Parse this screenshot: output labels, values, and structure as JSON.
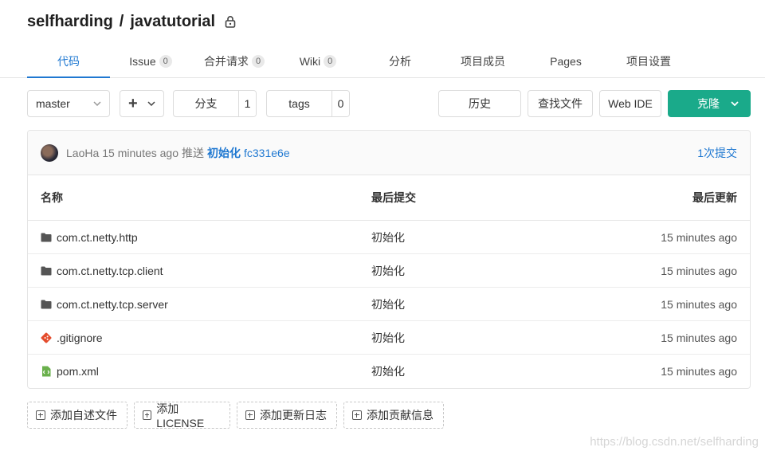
{
  "project": {
    "namespace": "selfharding",
    "separator": "/",
    "name": "javatutorial"
  },
  "tabs": [
    {
      "label": "代码",
      "active": true
    },
    {
      "label": "Issue",
      "count": "0"
    },
    {
      "label": "合并请求",
      "count": "0"
    },
    {
      "label": "Wiki",
      "count": "0"
    },
    {
      "label": "分析"
    },
    {
      "label": "项目成员"
    },
    {
      "label": "Pages"
    },
    {
      "label": "项目设置"
    }
  ],
  "toolbar": {
    "branch": "master",
    "add": "+",
    "branches_label": "分支",
    "branches_count": "1",
    "tags_label": "tags",
    "tags_count": "0",
    "history": "历史",
    "find_file": "查找文件",
    "web_ide": "Web IDE",
    "clone": "克隆"
  },
  "last_commit": {
    "author": "LaoHa",
    "time": "15 minutes ago",
    "action": "推送",
    "message": "初始化",
    "sha": "fc331e6e",
    "total": "1次提交"
  },
  "table": {
    "headers": {
      "name": "名称",
      "last_commit": "最后提交",
      "last_update": "最后更新"
    },
    "rows": [
      {
        "icon": "folder-icon",
        "name": "com.ct.netty.http",
        "commit": "初始化",
        "updated": "15 minutes ago"
      },
      {
        "icon": "folder-icon",
        "name": "com.ct.netty.tcp.client",
        "commit": "初始化",
        "updated": "15 minutes ago"
      },
      {
        "icon": "folder-icon",
        "name": "com.ct.netty.tcp.server",
        "commit": "初始化",
        "updated": "15 minutes ago"
      },
      {
        "icon": "git-file-icon",
        "name": ".gitignore",
        "commit": "初始化",
        "updated": "15 minutes ago"
      },
      {
        "icon": "xml-file-icon",
        "name": "pom.xml",
        "commit": "初始化",
        "updated": "15 minutes ago"
      }
    ]
  },
  "add_buttons": {
    "readme": "添加自述文件",
    "license": "添加LICENSE",
    "changelog": "添加更新日志",
    "contributing": "添加贡献信息"
  },
  "watermark": "https://blog.csdn.net/selfharding",
  "colors": {
    "accent": "#1f78d1",
    "clone": "#1aaa8a",
    "git_icon": "#e44c2c",
    "xml_icon": "#6ab04c"
  }
}
